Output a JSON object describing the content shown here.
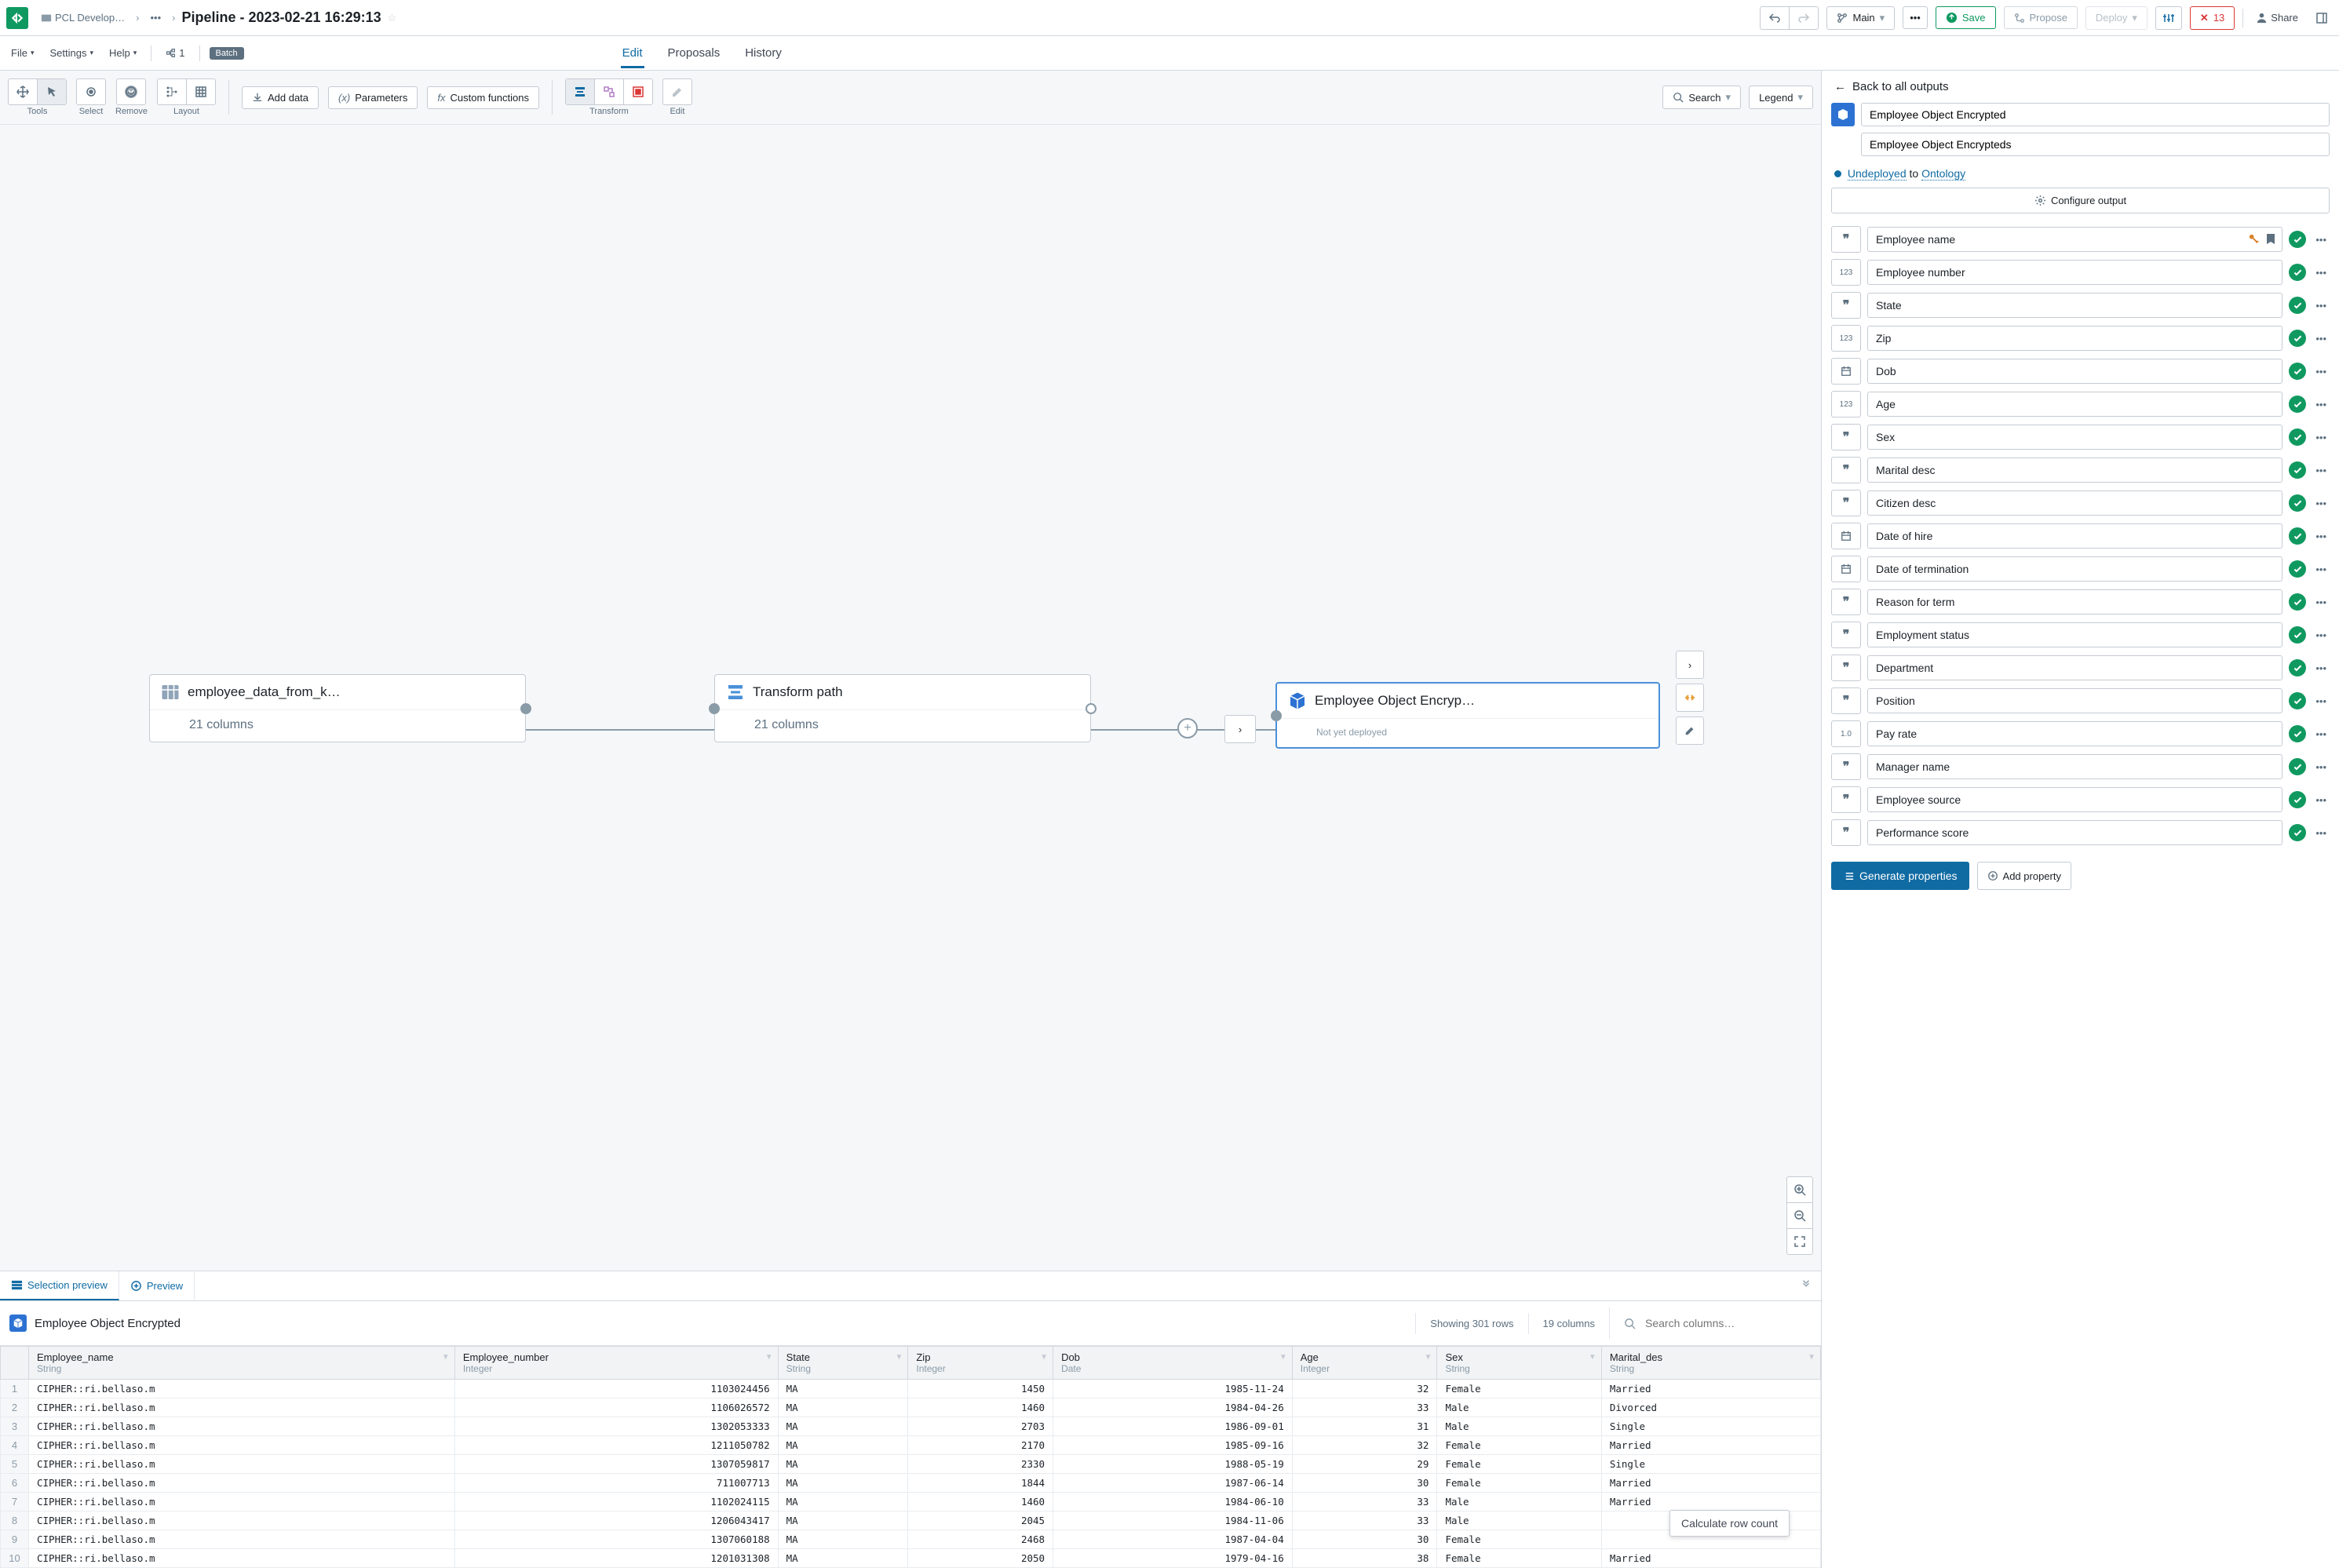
{
  "breadcrumb": {
    "project": "PCL Develop…",
    "ellipsis": "•••",
    "title": "Pipeline - 2023-02-21 16:29:13"
  },
  "menus": {
    "file": "File",
    "settings": "Settings",
    "help": "Help",
    "branch_count": "1",
    "badge": "Batch"
  },
  "tabs": {
    "edit": "Edit",
    "proposals": "Proposals",
    "history": "History"
  },
  "top_actions": {
    "main": "Main",
    "save": "Save",
    "propose": "Propose",
    "deploy": "Deploy",
    "error_count": "13",
    "share": "Share"
  },
  "toolbar": {
    "tools": "Tools",
    "select": "Select",
    "remove": "Remove",
    "layout": "Layout",
    "add_data": "Add data",
    "parameters": "Parameters",
    "custom_fns": "Custom functions",
    "transform": "Transform",
    "edit": "Edit",
    "search": "Search",
    "legend": "Legend"
  },
  "canvas": {
    "node1": {
      "title": "employee_data_from_k…",
      "sub": "21 columns"
    },
    "node2": {
      "title": "Transform path",
      "sub": "21 columns"
    },
    "node3": {
      "title": "Employee Object Encryp…",
      "sub": "Not yet deployed"
    }
  },
  "preview": {
    "tab_selection": "Selection preview",
    "tab_preview": "Preview",
    "object_name": "Employee Object Encrypted",
    "row_info": "Showing 301 rows",
    "col_info": "19 columns",
    "search_placeholder": "Search columns…",
    "tooltip": "Calculate row count"
  },
  "columns": [
    {
      "name": "Employee_name",
      "type": "String"
    },
    {
      "name": "Employee_number",
      "type": "Integer"
    },
    {
      "name": "State",
      "type": "String"
    },
    {
      "name": "Zip",
      "type": "Integer"
    },
    {
      "name": "Dob",
      "type": "Date"
    },
    {
      "name": "Age",
      "type": "Integer"
    },
    {
      "name": "Sex",
      "type": "String"
    },
    {
      "name": "Marital_des",
      "type": "String"
    }
  ],
  "rows": [
    {
      "n": "1",
      "name": "CIPHER::ri.bellaso.m",
      "num": "1103024456",
      "state": "MA",
      "zip": "1450",
      "dob": "1985-11-24",
      "age": "32",
      "sex": "Female",
      "marital": "Married"
    },
    {
      "n": "2",
      "name": "CIPHER::ri.bellaso.m",
      "num": "1106026572",
      "state": "MA",
      "zip": "1460",
      "dob": "1984-04-26",
      "age": "33",
      "sex": "Male",
      "marital": "Divorced"
    },
    {
      "n": "3",
      "name": "CIPHER::ri.bellaso.m",
      "num": "1302053333",
      "state": "MA",
      "zip": "2703",
      "dob": "1986-09-01",
      "age": "31",
      "sex": "Male",
      "marital": "Single"
    },
    {
      "n": "4",
      "name": "CIPHER::ri.bellaso.m",
      "num": "1211050782",
      "state": "MA",
      "zip": "2170",
      "dob": "1985-09-16",
      "age": "32",
      "sex": "Female",
      "marital": "Married"
    },
    {
      "n": "5",
      "name": "CIPHER::ri.bellaso.m",
      "num": "1307059817",
      "state": "MA",
      "zip": "2330",
      "dob": "1988-05-19",
      "age": "29",
      "sex": "Female",
      "marital": "Single"
    },
    {
      "n": "6",
      "name": "CIPHER::ri.bellaso.m",
      "num": "711007713",
      "state": "MA",
      "zip": "1844",
      "dob": "1987-06-14",
      "age": "30",
      "sex": "Female",
      "marital": "Married"
    },
    {
      "n": "7",
      "name": "CIPHER::ri.bellaso.m",
      "num": "1102024115",
      "state": "MA",
      "zip": "1460",
      "dob": "1984-06-10",
      "age": "33",
      "sex": "Male",
      "marital": "Married"
    },
    {
      "n": "8",
      "name": "CIPHER::ri.bellaso.m",
      "num": "1206043417",
      "state": "MA",
      "zip": "2045",
      "dob": "1984-11-06",
      "age": "33",
      "sex": "Male",
      "marital": ""
    },
    {
      "n": "9",
      "name": "CIPHER::ri.bellaso.m",
      "num": "1307060188",
      "state": "MA",
      "zip": "2468",
      "dob": "1987-04-04",
      "age": "30",
      "sex": "Female",
      "marital": ""
    },
    {
      "n": "10",
      "name": "CIPHER::ri.bellaso.m",
      "num": "1201031308",
      "state": "MA",
      "zip": "2050",
      "dob": "1979-04-16",
      "age": "38",
      "sex": "Female",
      "marital": "Married"
    }
  ],
  "rp": {
    "back": "Back to all outputs",
    "name1": "Employee Object Encrypted",
    "name2": "Employee Object Encrypteds",
    "undeployed": "Undeployed",
    "to": " to ",
    "ontology": "Ontology",
    "configure": "Configure output",
    "generate": "Generate properties",
    "add_prop": "Add property"
  },
  "properties": [
    {
      "type": "quote",
      "label": "Employee name",
      "key": true
    },
    {
      "type": "123",
      "label": "Employee number"
    },
    {
      "type": "quote",
      "label": "State"
    },
    {
      "type": "123",
      "label": "Zip"
    },
    {
      "type": "cal",
      "label": "Dob"
    },
    {
      "type": "123",
      "label": "Age"
    },
    {
      "type": "quote",
      "label": "Sex"
    },
    {
      "type": "quote",
      "label": "Marital desc"
    },
    {
      "type": "quote",
      "label": "Citizen desc"
    },
    {
      "type": "cal",
      "label": "Date of hire"
    },
    {
      "type": "cal",
      "label": "Date of termination"
    },
    {
      "type": "quote",
      "label": "Reason for term"
    },
    {
      "type": "quote",
      "label": "Employment status"
    },
    {
      "type": "quote",
      "label": "Department"
    },
    {
      "type": "quote",
      "label": "Position"
    },
    {
      "type": "1.0",
      "label": "Pay rate"
    },
    {
      "type": "quote",
      "label": "Manager name"
    },
    {
      "type": "quote",
      "label": "Employee source"
    },
    {
      "type": "quote",
      "label": "Performance score"
    }
  ]
}
